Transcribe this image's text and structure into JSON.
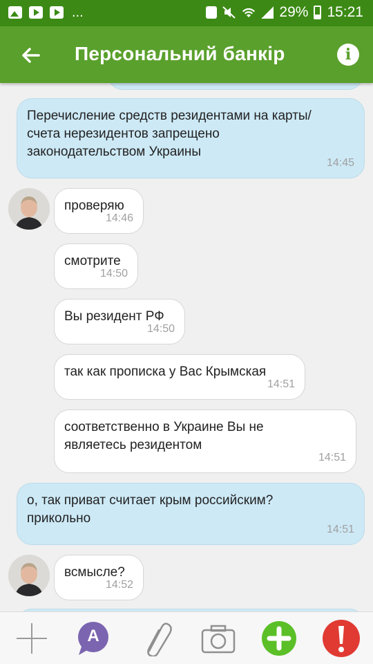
{
  "status_bar": {
    "battery": "29%",
    "time": "15:21",
    "notifications": [
      "gallery-icon",
      "youtube-icon",
      "youtube-icon",
      "more-dots"
    ],
    "system_icons": [
      "battery-saver-icon",
      "mute-icon",
      "wifi-icon",
      "signal-icon",
      "battery-icon"
    ]
  },
  "app_bar": {
    "title": "Персональний банкір",
    "back_icon": "arrow-left",
    "info_icon": "info"
  },
  "messages": [
    {
      "dir": "out",
      "text": "Перечисление средств резидентами на карты/счета нерезидентов запрещено законодательством Украины",
      "time": "14:45"
    },
    {
      "dir": "in",
      "text": "проверяю",
      "time": "14:46",
      "avatar": true
    },
    {
      "dir": "in",
      "text": "смотрите",
      "time": "14:50"
    },
    {
      "dir": "in",
      "text": "Вы резидент РФ",
      "time": "14:50"
    },
    {
      "dir": "in",
      "text": "так как прописка у Вас Крымская",
      "time": "14:51"
    },
    {
      "dir": "in",
      "text": "соответственно в Украине Вы не являетесь резидентом",
      "time": "14:51"
    },
    {
      "dir": "out",
      "text": "о, так приват считает крым российским? прикольно",
      "time": "14:51"
    },
    {
      "dir": "in",
      "text": "всмысле?",
      "time": "14:52",
      "avatar": true
    }
  ],
  "toolbar": {
    "items": [
      "plus-icon",
      "sticker-a-icon",
      "paperclip-icon",
      "camera-icon",
      "green-plus-icon",
      "alert-icon"
    ],
    "sticker_letter": "A"
  },
  "colors": {
    "status_bar": "#3c8a15",
    "app_bar": "#5aa02c",
    "outgoing_bubble": "#cde9f6",
    "incoming_bubble": "#ffffff",
    "alert": "#e03a33"
  }
}
